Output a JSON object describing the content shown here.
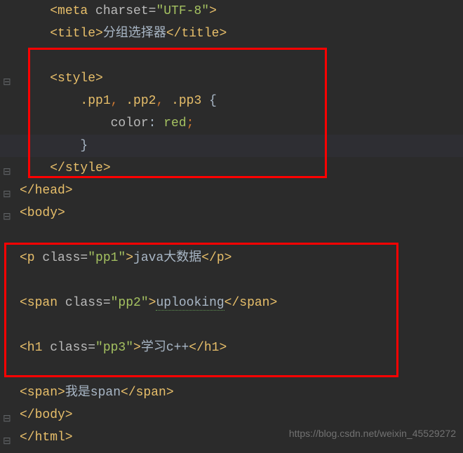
{
  "lines": {
    "l1_tag_open": "<meta ",
    "l1_attr": "charset=",
    "l1_val": "\"UTF-8\"",
    "l1_close": ">",
    "l2_open": "<title>",
    "l2_text": "分组选择器",
    "l2_close": "</title>",
    "l4_open": "<style>",
    "l5_sel1": ".pp1",
    "l5_c1": ",",
    "l5_sel2": " .pp2",
    "l5_c2": ",",
    "l5_sel3": " .pp3 ",
    "l5_brace": "{",
    "l6_prop": "color",
    "l6_colon": ": ",
    "l6_val": "red",
    "l6_semi": ";",
    "l7_brace": "}",
    "l8_close": "</style>",
    "l9": "</head>",
    "l10": "<body>",
    "l12_open": "<p ",
    "l12_attr": "class=",
    "l12_val": "\"pp1\"",
    "l12_gt": ">",
    "l12_text": "java大数据",
    "l12_close": "</p>",
    "l14_open": "<span ",
    "l14_attr": "class=",
    "l14_val": "\"pp2\"",
    "l14_gt": ">",
    "l14_text": "uplooking",
    "l14_close": "</span>",
    "l16_open": "<h1 ",
    "l16_attr": "class=",
    "l16_val": "\"pp3\"",
    "l16_gt": ">",
    "l16_text": "学习c++",
    "l16_close": "</h1>",
    "l18_open": "<span>",
    "l18_text": "我是span",
    "l18_close": "</span>",
    "l19": "</body>",
    "l20": "</html>"
  },
  "watermark": "https://blog.csdn.net/weixin_45529272"
}
